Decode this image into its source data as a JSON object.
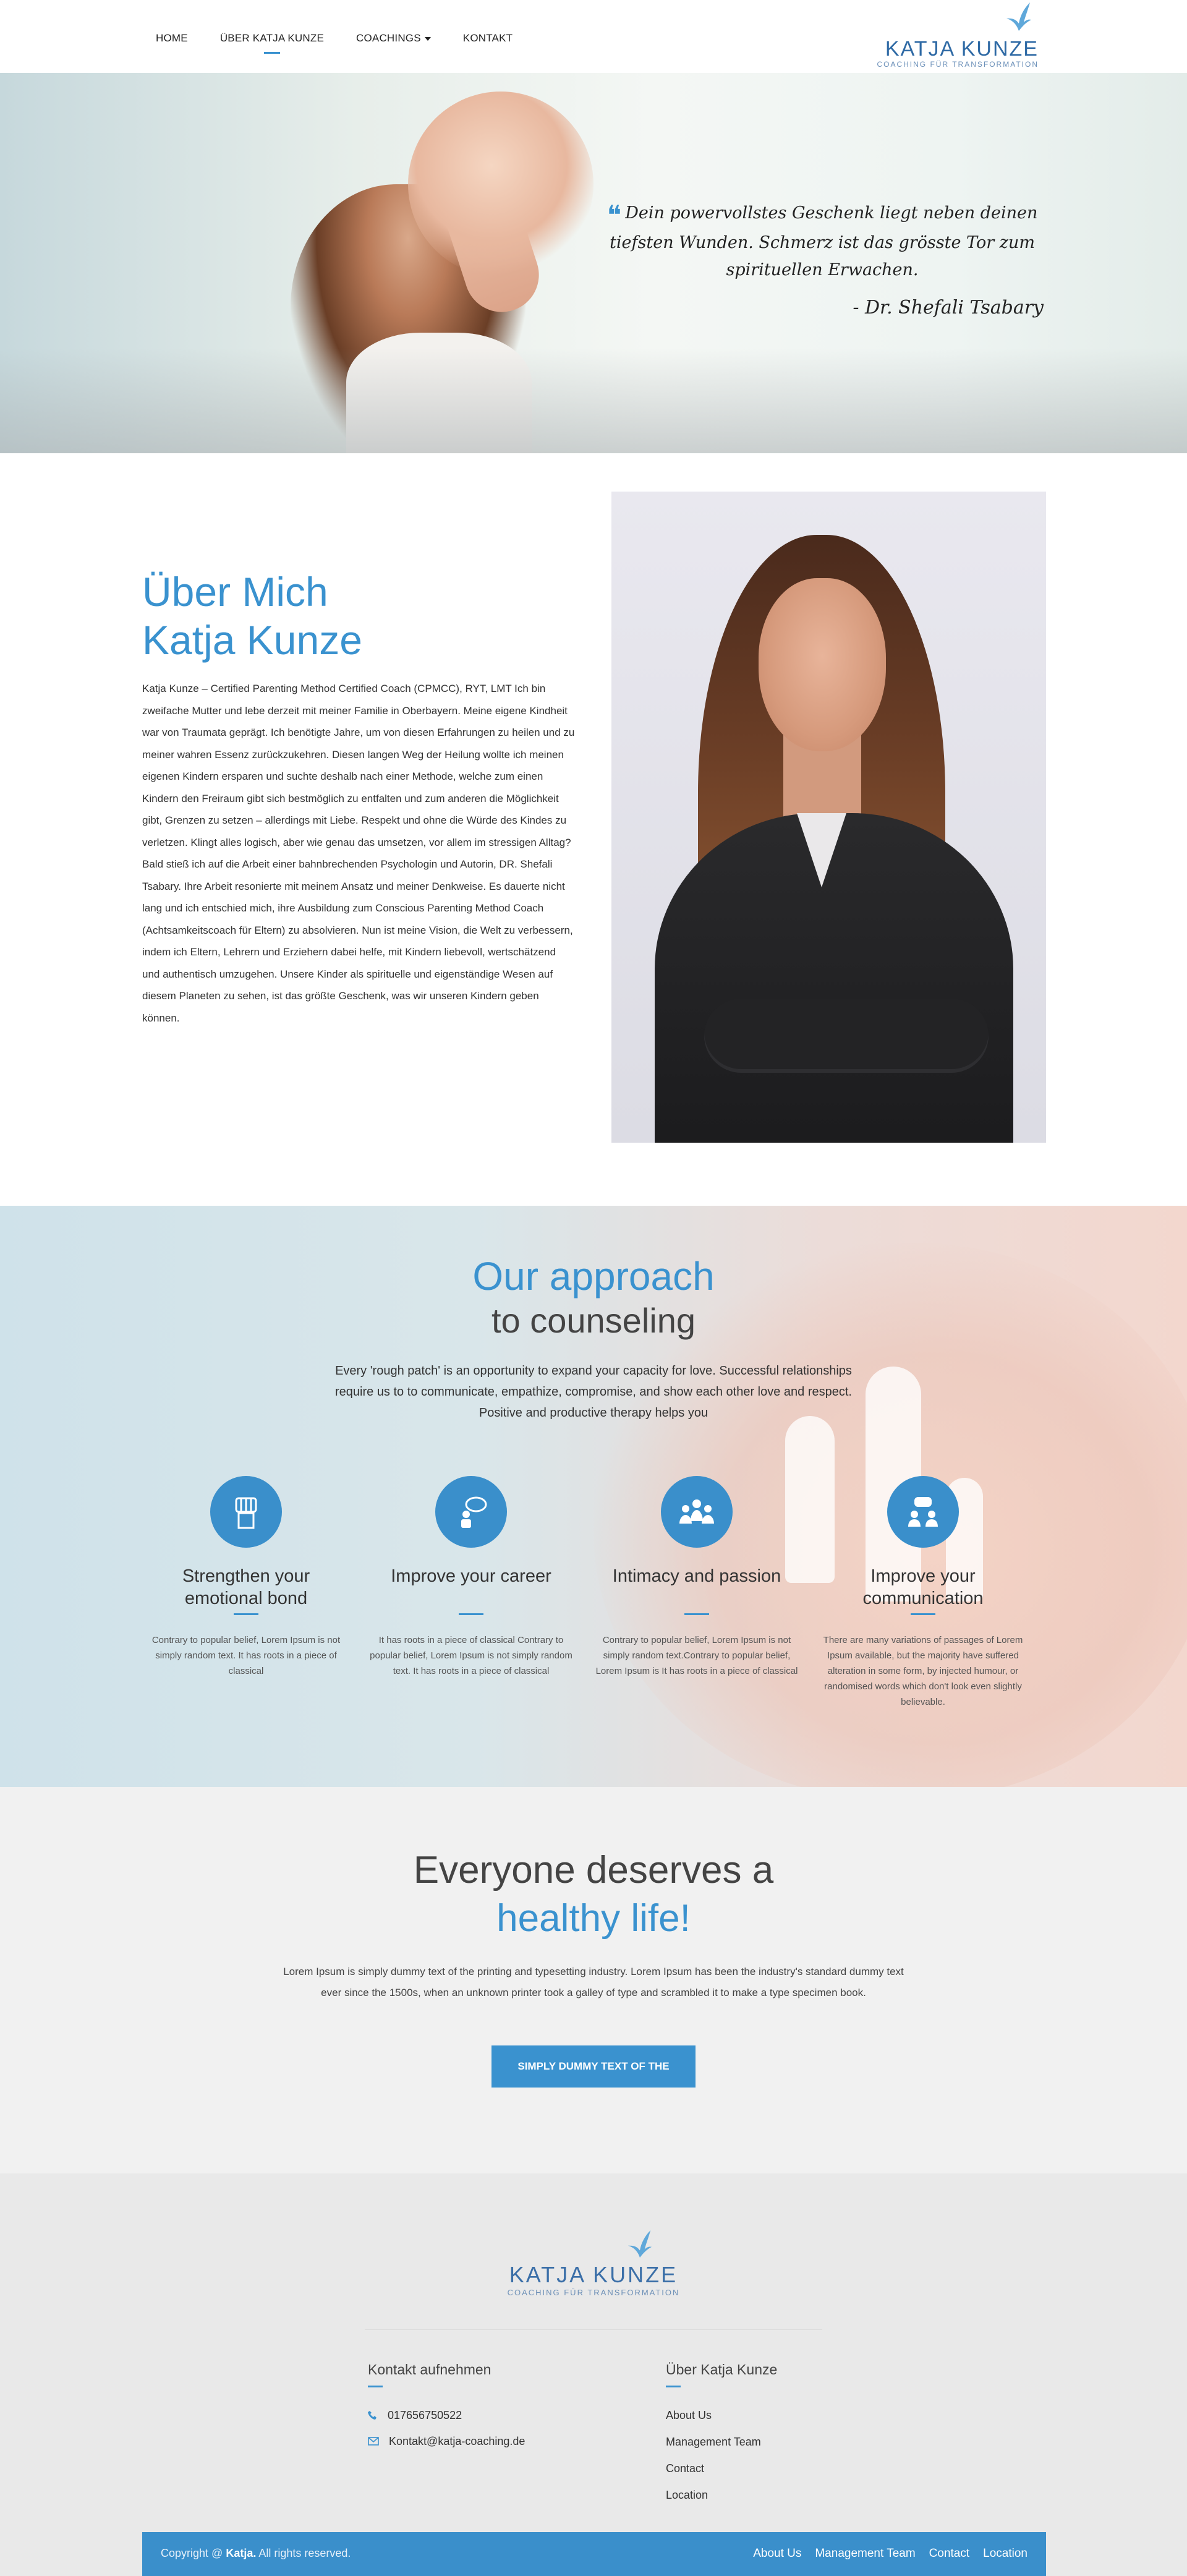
{
  "nav": {
    "items": [
      {
        "label": "HOME"
      },
      {
        "label": "ÜBER KATJA KUNZE"
      },
      {
        "label": "COACHINGS"
      },
      {
        "label": "KONTAKT"
      }
    ],
    "logo": {
      "name": "KATJA KUNZE",
      "tagline": "COACHING FÜR TRANSFORMATION"
    }
  },
  "hero": {
    "quote": "Dein powervollstes Geschenk liegt neben deinen tiefsten Wunden. Schmerz ist das grösste Tor zum spirituellen Erwachen.",
    "author": "- Dr. Shefali Tsabary"
  },
  "about": {
    "title_line1": "Über Mich",
    "title_line2": "Katja Kunze",
    "text": "Katja Kunze – Certified Parenting Method Certified Coach (CPMCC), RYT, LMT Ich bin zweifache Mutter und lebe derzeit mit meiner Familie in Oberbayern. Meine eigene Kindheit war von Traumata geprägt. Ich benötigte Jahre, um von diesen Erfahrungen zu heilen und zu meiner wahren Essenz zurückzukehren. Diesen langen Weg der Heilung wollte ich meinen eigenen Kindern ersparen und suchte deshalb nach einer Methode, welche zum einen Kindern den Freiraum gibt sich bestmöglich zu entfalten und zum anderen die Möglichkeit gibt, Grenzen zu setzen – allerdings mit Liebe. Respekt und ohne die Würde des Kindes zu verletzen. Klingt alles logisch, aber wie genau das umsetzen, vor allem im stressigen Alltag? Bald stieß ich auf die Arbeit einer bahnbrechenden Psychologin und Autorin, DR. Shefali Tsabary. Ihre Arbeit resonierte mit meinem Ansatz und meiner Denkweise. Es dauerte nicht lang und ich entschied mich, ihre Ausbildung zum Conscious Parenting Method Coach (Achtsamkeitscoach für Eltern) zu absolvieren. Nun ist meine Vision, die Welt zu verbessern, indem ich Eltern, Lehrern und Erziehern dabei helfe, mit Kindern liebevoll, wertschätzend und authentisch umzugehen. Unsere Kinder als spirituelle und eigenständige Wesen auf diesem Planeten zu sehen, ist das größte Geschenk, was wir unseren Kindern geben können."
  },
  "approach": {
    "title_line1": "Our approach",
    "title_line2": "to counseling",
    "intro": "Every 'rough patch' is an opportunity to expand your capacity for love. Successful relationships require us to to communicate, empathize, compromise, and show each other love and respect. Positive and productive therapy helps you",
    "features": [
      {
        "icon": "fist-icon",
        "title": "Strengthen your emotional bond",
        "text": "Contrary to popular belief, Lorem Ipsum is not simply random text. It has roots in a piece of classical"
      },
      {
        "icon": "career-icon",
        "title": "Improve your career",
        "text": "It has roots in a piece of classical Contrary to popular belief, Lorem Ipsum is not simply random text. It has roots in a piece of classical"
      },
      {
        "icon": "group-icon",
        "title": "Intimacy and passion",
        "text": "Contrary to popular belief, Lorem Ipsum is not simply random text.Contrary to popular belief, Lorem Ipsum is It has roots in a piece of classical"
      },
      {
        "icon": "communication-icon",
        "title": "Improve your communication",
        "text": "There are many variations of passages of Lorem Ipsum available, but the majority have suffered alteration in some form, by injected humour, or randomised words which don't look even slightly believable."
      }
    ]
  },
  "healthy": {
    "title_line1": "Everyone deserves a",
    "title_line2": "healthy life!",
    "text": "Lorem Ipsum is simply dummy text of the printing and typesetting industry. Lorem Ipsum has been the industry's standard dummy text ever since the 1500s, when an unknown printer took a galley of type and scrambled it to make a type specimen book.",
    "button": "SIMPLY DUMMY TEXT OF THE"
  },
  "footer": {
    "logo": {
      "name": "KATJA KUNZE",
      "tagline": "COACHING FÜR TRANSFORMATION"
    },
    "contact_title": "Kontakt aufnehmen",
    "phone": "017656750522",
    "email": "Kontakt@katja-coaching.de",
    "about_title": "Über Katja Kunze",
    "about_links": [
      "About Us",
      "Management Team",
      "Contact",
      "Location"
    ],
    "copyright_prefix": "Copyright @",
    "copyright_brand": "Katja.",
    "copyright_suffix": "All rights reserved.",
    "bar_links": [
      "About Us",
      "Management Team",
      "Contact",
      "Location"
    ]
  },
  "colors": {
    "accent": "#3a92cf",
    "text": "#444444",
    "footer_bg": "#e9e9e9",
    "section_bg": "#f1f1f1"
  }
}
